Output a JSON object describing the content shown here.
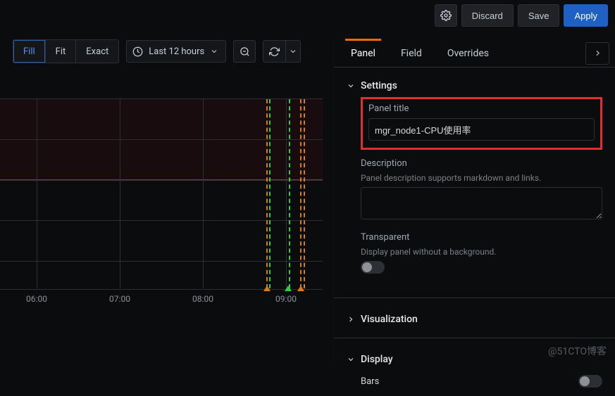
{
  "toolbar": {
    "discard": "Discard",
    "save": "Save",
    "apply": "Apply"
  },
  "view_modes": {
    "fill": "Fill",
    "fit": "Fit",
    "exact": "Exact"
  },
  "time_range": "Last 12 hours",
  "tabs": {
    "panel": "Panel",
    "field": "Field",
    "overrides": "Overrides"
  },
  "sections": {
    "settings": "Settings",
    "visualization": "Visualization",
    "display": "Display"
  },
  "settings": {
    "panel_title_label": "Panel title",
    "panel_title_value": "mgr_node1-CPU使用率",
    "description_label": "Description",
    "description_help": "Panel description supports markdown and links.",
    "transparent_label": "Transparent",
    "transparent_help": "Display panel without a background."
  },
  "display": {
    "bars": "Bars"
  },
  "watermark": "@51CTO博客",
  "chart_data": {
    "type": "line",
    "x_ticks": [
      "06:00",
      "07:00",
      "08:00",
      "09:00"
    ],
    "title": "",
    "xlabel": "",
    "ylabel": "",
    "threshold_band": {
      "color": "#b22",
      "position": "top"
    },
    "annotations": [
      {
        "time": "09:04",
        "color": "orange"
      },
      {
        "time": "09:05",
        "color": "green"
      },
      {
        "time": "09:07",
        "color": "green"
      },
      {
        "time": "09:09",
        "color": "orange"
      },
      {
        "time": "09:12",
        "color": "orange"
      }
    ],
    "series": []
  }
}
